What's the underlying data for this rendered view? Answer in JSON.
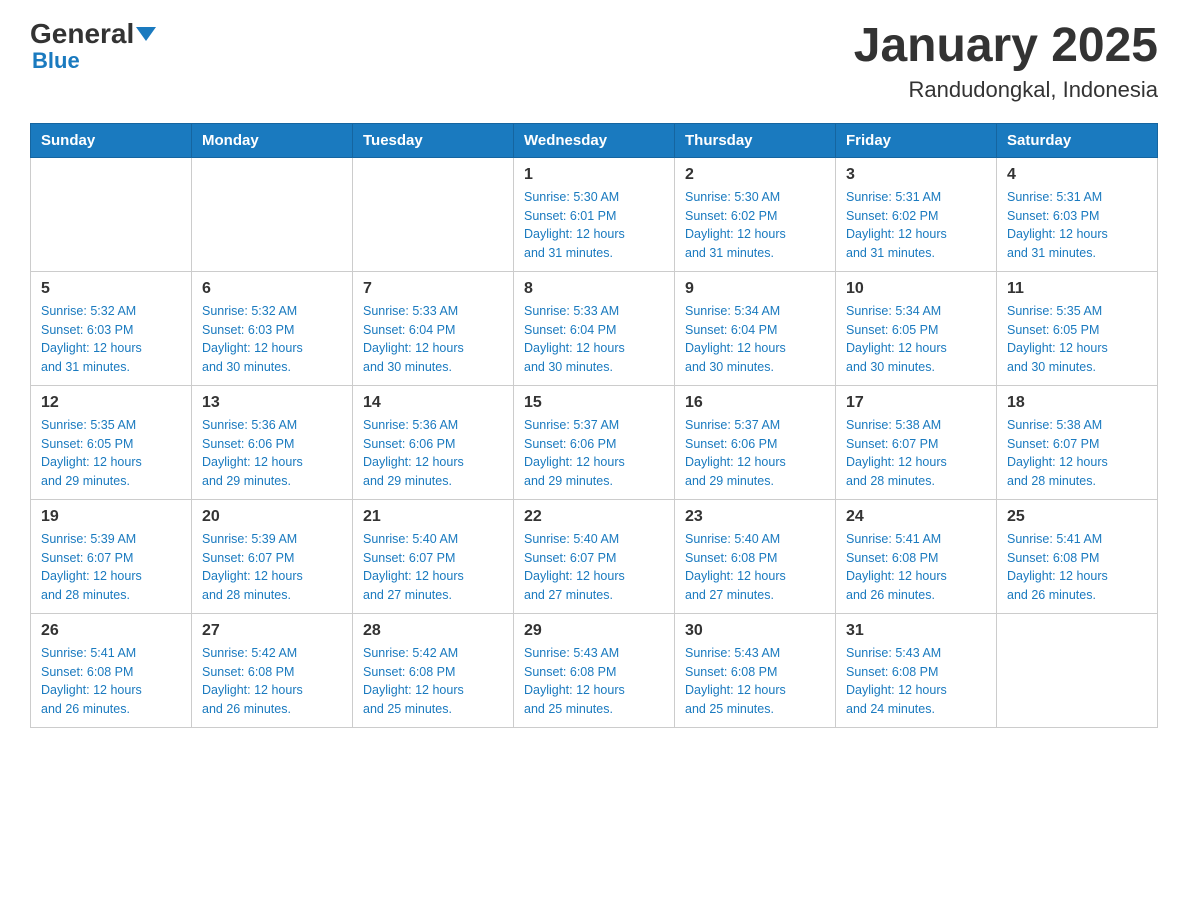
{
  "header": {
    "logo_general": "General",
    "logo_blue": "Blue",
    "title": "January 2025",
    "subtitle": "Randudongkal, Indonesia"
  },
  "days_of_week": [
    "Sunday",
    "Monday",
    "Tuesday",
    "Wednesday",
    "Thursday",
    "Friday",
    "Saturday"
  ],
  "weeks": [
    [
      {
        "day": "",
        "info": ""
      },
      {
        "day": "",
        "info": ""
      },
      {
        "day": "",
        "info": ""
      },
      {
        "day": "1",
        "info": "Sunrise: 5:30 AM\nSunset: 6:01 PM\nDaylight: 12 hours\nand 31 minutes."
      },
      {
        "day": "2",
        "info": "Sunrise: 5:30 AM\nSunset: 6:02 PM\nDaylight: 12 hours\nand 31 minutes."
      },
      {
        "day": "3",
        "info": "Sunrise: 5:31 AM\nSunset: 6:02 PM\nDaylight: 12 hours\nand 31 minutes."
      },
      {
        "day": "4",
        "info": "Sunrise: 5:31 AM\nSunset: 6:03 PM\nDaylight: 12 hours\nand 31 minutes."
      }
    ],
    [
      {
        "day": "5",
        "info": "Sunrise: 5:32 AM\nSunset: 6:03 PM\nDaylight: 12 hours\nand 31 minutes."
      },
      {
        "day": "6",
        "info": "Sunrise: 5:32 AM\nSunset: 6:03 PM\nDaylight: 12 hours\nand 30 minutes."
      },
      {
        "day": "7",
        "info": "Sunrise: 5:33 AM\nSunset: 6:04 PM\nDaylight: 12 hours\nand 30 minutes."
      },
      {
        "day": "8",
        "info": "Sunrise: 5:33 AM\nSunset: 6:04 PM\nDaylight: 12 hours\nand 30 minutes."
      },
      {
        "day": "9",
        "info": "Sunrise: 5:34 AM\nSunset: 6:04 PM\nDaylight: 12 hours\nand 30 minutes."
      },
      {
        "day": "10",
        "info": "Sunrise: 5:34 AM\nSunset: 6:05 PM\nDaylight: 12 hours\nand 30 minutes."
      },
      {
        "day": "11",
        "info": "Sunrise: 5:35 AM\nSunset: 6:05 PM\nDaylight: 12 hours\nand 30 minutes."
      }
    ],
    [
      {
        "day": "12",
        "info": "Sunrise: 5:35 AM\nSunset: 6:05 PM\nDaylight: 12 hours\nand 29 minutes."
      },
      {
        "day": "13",
        "info": "Sunrise: 5:36 AM\nSunset: 6:06 PM\nDaylight: 12 hours\nand 29 minutes."
      },
      {
        "day": "14",
        "info": "Sunrise: 5:36 AM\nSunset: 6:06 PM\nDaylight: 12 hours\nand 29 minutes."
      },
      {
        "day": "15",
        "info": "Sunrise: 5:37 AM\nSunset: 6:06 PM\nDaylight: 12 hours\nand 29 minutes."
      },
      {
        "day": "16",
        "info": "Sunrise: 5:37 AM\nSunset: 6:06 PM\nDaylight: 12 hours\nand 29 minutes."
      },
      {
        "day": "17",
        "info": "Sunrise: 5:38 AM\nSunset: 6:07 PM\nDaylight: 12 hours\nand 28 minutes."
      },
      {
        "day": "18",
        "info": "Sunrise: 5:38 AM\nSunset: 6:07 PM\nDaylight: 12 hours\nand 28 minutes."
      }
    ],
    [
      {
        "day": "19",
        "info": "Sunrise: 5:39 AM\nSunset: 6:07 PM\nDaylight: 12 hours\nand 28 minutes."
      },
      {
        "day": "20",
        "info": "Sunrise: 5:39 AM\nSunset: 6:07 PM\nDaylight: 12 hours\nand 28 minutes."
      },
      {
        "day": "21",
        "info": "Sunrise: 5:40 AM\nSunset: 6:07 PM\nDaylight: 12 hours\nand 27 minutes."
      },
      {
        "day": "22",
        "info": "Sunrise: 5:40 AM\nSunset: 6:07 PM\nDaylight: 12 hours\nand 27 minutes."
      },
      {
        "day": "23",
        "info": "Sunrise: 5:40 AM\nSunset: 6:08 PM\nDaylight: 12 hours\nand 27 minutes."
      },
      {
        "day": "24",
        "info": "Sunrise: 5:41 AM\nSunset: 6:08 PM\nDaylight: 12 hours\nand 26 minutes."
      },
      {
        "day": "25",
        "info": "Sunrise: 5:41 AM\nSunset: 6:08 PM\nDaylight: 12 hours\nand 26 minutes."
      }
    ],
    [
      {
        "day": "26",
        "info": "Sunrise: 5:41 AM\nSunset: 6:08 PM\nDaylight: 12 hours\nand 26 minutes."
      },
      {
        "day": "27",
        "info": "Sunrise: 5:42 AM\nSunset: 6:08 PM\nDaylight: 12 hours\nand 26 minutes."
      },
      {
        "day": "28",
        "info": "Sunrise: 5:42 AM\nSunset: 6:08 PM\nDaylight: 12 hours\nand 25 minutes."
      },
      {
        "day": "29",
        "info": "Sunrise: 5:43 AM\nSunset: 6:08 PM\nDaylight: 12 hours\nand 25 minutes."
      },
      {
        "day": "30",
        "info": "Sunrise: 5:43 AM\nSunset: 6:08 PM\nDaylight: 12 hours\nand 25 minutes."
      },
      {
        "day": "31",
        "info": "Sunrise: 5:43 AM\nSunset: 6:08 PM\nDaylight: 12 hours\nand 24 minutes."
      },
      {
        "day": "",
        "info": ""
      }
    ]
  ]
}
